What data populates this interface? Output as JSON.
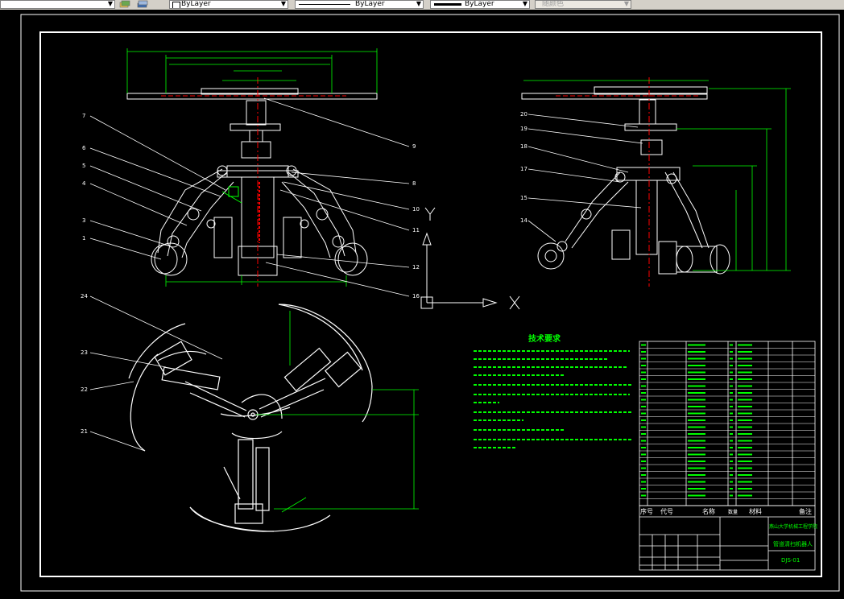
{
  "toolbar": {
    "layer_combo": {
      "value": "ByLayer"
    },
    "linetype_combo": {
      "value": "ByLayer"
    },
    "lineweight_combo": {
      "value": "ByLayer"
    },
    "plotstyle_combo": {
      "value": "随颜色"
    }
  },
  "drawing": {
    "ucs_x_label": "X",
    "ucs_y_label": "Y",
    "tech_title": "技术要求",
    "front_view_callouts": [
      "7",
      "6",
      "5",
      "4",
      "3",
      "1",
      "9",
      "8",
      "10",
      "11",
      "12",
      "16"
    ],
    "side_view_callouts": [
      "20",
      "19",
      "18",
      "17",
      "15",
      "14"
    ],
    "top_view_callouts": [
      "24",
      "23",
      "22",
      "21"
    ],
    "title_block": {
      "col_seq": "序号",
      "col_code": "代号",
      "col_name": "名称",
      "col_qty": "数量",
      "col_material": "材料",
      "col_note": "备注",
      "school": "燕山大学机械工程学院",
      "drawing_name": "管道清扫机器人",
      "drawing_no": "DJS-01"
    }
  },
  "colors": {
    "background": "#000000",
    "geometry": "#ffffff",
    "dimension": "#00ff00",
    "text": "#00ff00",
    "center": "#ff0000",
    "highlight": "#ffff00",
    "toolbar": "#d4d0c8"
  }
}
